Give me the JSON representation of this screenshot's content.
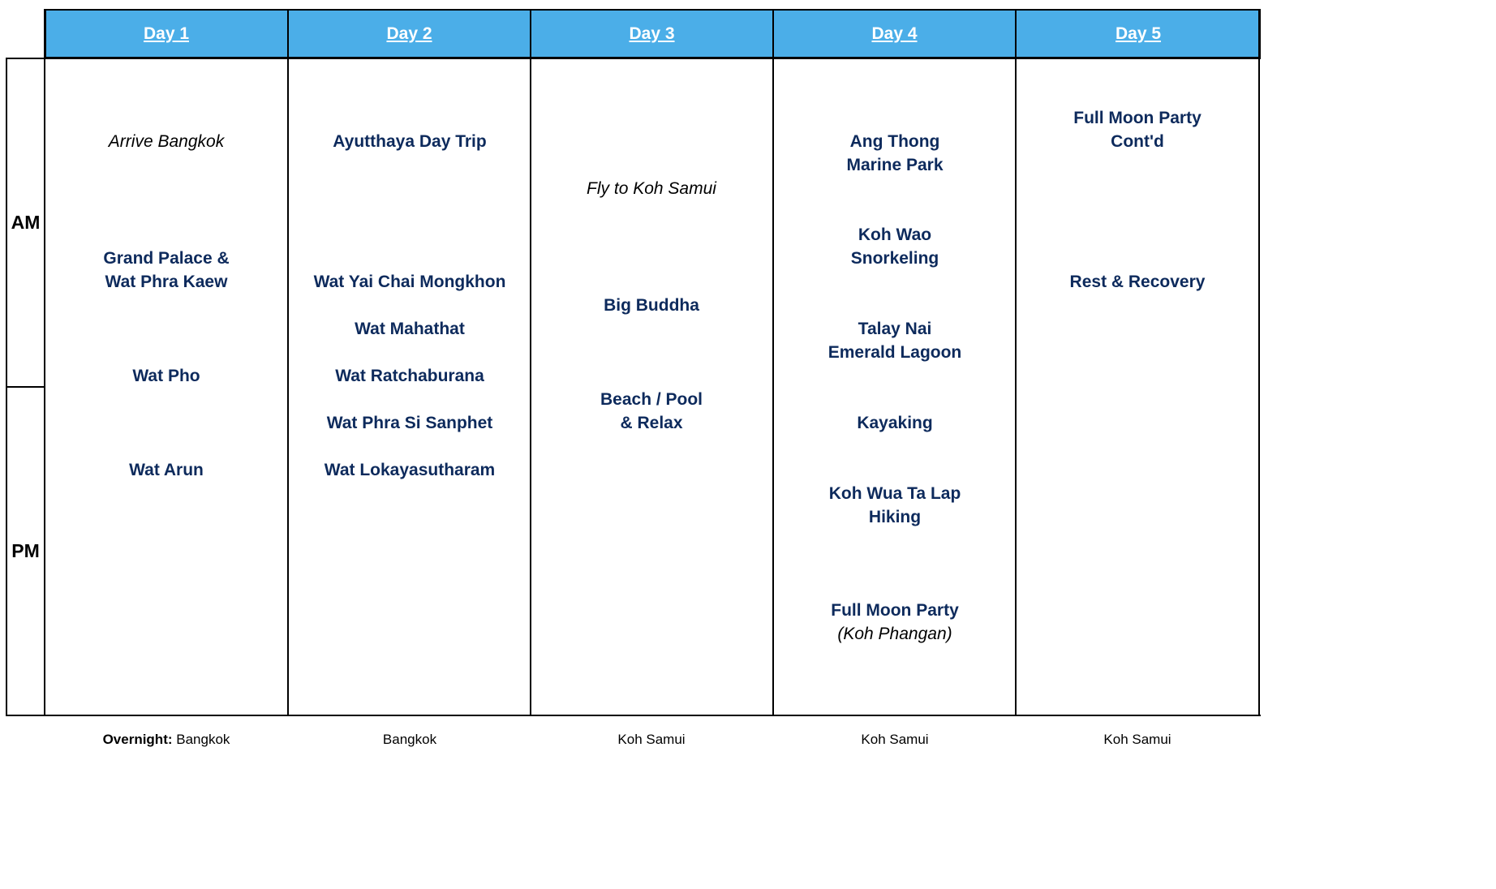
{
  "colors": {
    "header_bg": "#4baee8",
    "header_text": "#ffffff",
    "activity_text": "#0d2a5c",
    "note_text": "#000000",
    "border": "#000000"
  },
  "header": {
    "days": [
      "Day 1",
      "Day 2",
      "Day 3",
      "Day 4",
      "Day 5"
    ]
  },
  "periods": {
    "am": "AM",
    "pm": "PM"
  },
  "days": [
    {
      "items": [
        {
          "text": "Arrive Bangkok",
          "style": "note"
        },
        {
          "text": "Grand Palace &\nWat Phra Kaew",
          "style": "activity"
        },
        {
          "text": "Wat Pho",
          "style": "activity"
        },
        {
          "text": "Wat Arun",
          "style": "activity"
        }
      ]
    },
    {
      "items": [
        {
          "text": "Ayutthaya Day Trip",
          "style": "activity"
        },
        {
          "text": "Wat Yai Chai Mongkhon",
          "style": "activity"
        },
        {
          "text": "Wat Mahathat",
          "style": "activity"
        },
        {
          "text": "Wat Ratchaburana",
          "style": "activity"
        },
        {
          "text": "Wat Phra Si Sanphet",
          "style": "activity"
        },
        {
          "text": "Wat Lokayasutharam",
          "style": "activity"
        }
      ]
    },
    {
      "items": [
        {
          "text": "Fly to Koh Samui",
          "style": "note"
        },
        {
          "text": "Big Buddha",
          "style": "activity"
        },
        {
          "text": "Beach / Pool\n& Relax",
          "style": "activity"
        }
      ]
    },
    {
      "items": [
        {
          "text": "Ang Thong\nMarine Park",
          "style": "activity"
        },
        {
          "text": "Koh Wao\nSnorkeling",
          "style": "activity"
        },
        {
          "text": "Talay Nai\nEmerald Lagoon",
          "style": "activity"
        },
        {
          "text": "Kayaking",
          "style": "activity"
        },
        {
          "text": "Koh Wua Ta Lap\nHiking",
          "style": "activity"
        },
        {
          "text": "Full Moon Party",
          "style": "activity",
          "subtext": "(Koh Phangan)"
        }
      ]
    },
    {
      "items": [
        {
          "text": "Full Moon Party\nCont'd",
          "style": "activity"
        },
        {
          "text": "Rest & Recovery",
          "style": "activity"
        }
      ]
    }
  ],
  "footer": {
    "overnight_label": "Overnight:",
    "locations": [
      "Bangkok",
      "Bangkok",
      "Koh Samui",
      "Koh Samui",
      "Koh Samui"
    ]
  }
}
